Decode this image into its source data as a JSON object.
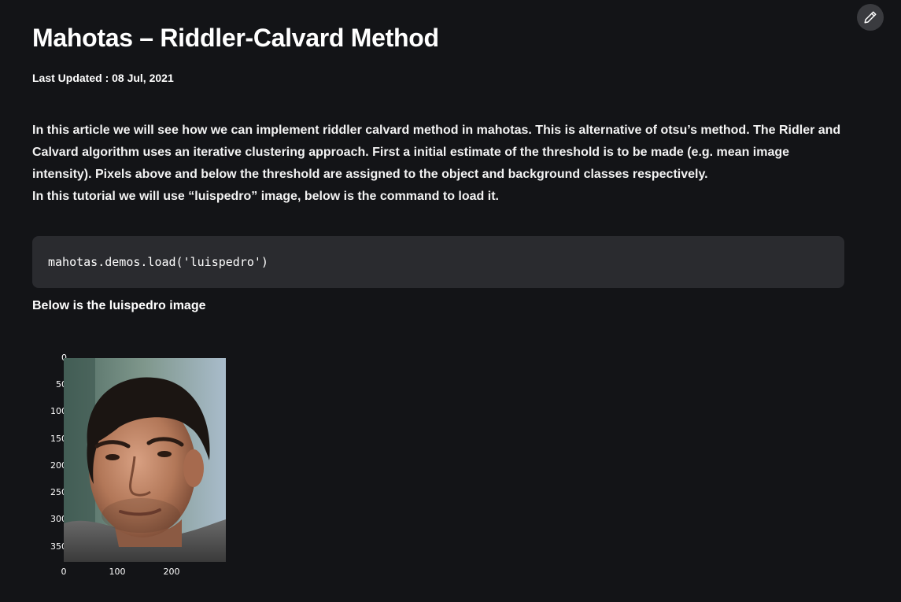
{
  "article": {
    "title": "Mahotas – Riddler-Calvard Method",
    "last_updated": "Last Updated : 08 Jul, 2021",
    "intro_lines": [
      "In this article we will see how we can implement riddler calvard method in mahotas. This is alternative of otsu’s method. The Ridler and",
      "Calvard algorithm uses an iterative clustering approach. First a initial estimate of the threshold is to be made (e.g. mean image",
      "intensity). Pixels above and below the threshold are assigned to the object and background classes respectively.",
      "In this tutorial we will use “luispedro” image, below is the command to load it."
    ],
    "code": "mahotas.demos.load('luispedro')",
    "below_text": "Below is the luispedro image"
  },
  "figure": {
    "y_ticks": [
      "0",
      "50",
      "100",
      "150",
      "200",
      "250",
      "300",
      "350"
    ],
    "x_ticks": [
      "0",
      "100",
      "200"
    ],
    "image_subject": "portrait-photo"
  },
  "icons": {
    "edit": "pencil-icon"
  },
  "colors": {
    "background": "#131417",
    "code_background": "#2a2b2f",
    "edit_button": "#3a3b3f"
  }
}
